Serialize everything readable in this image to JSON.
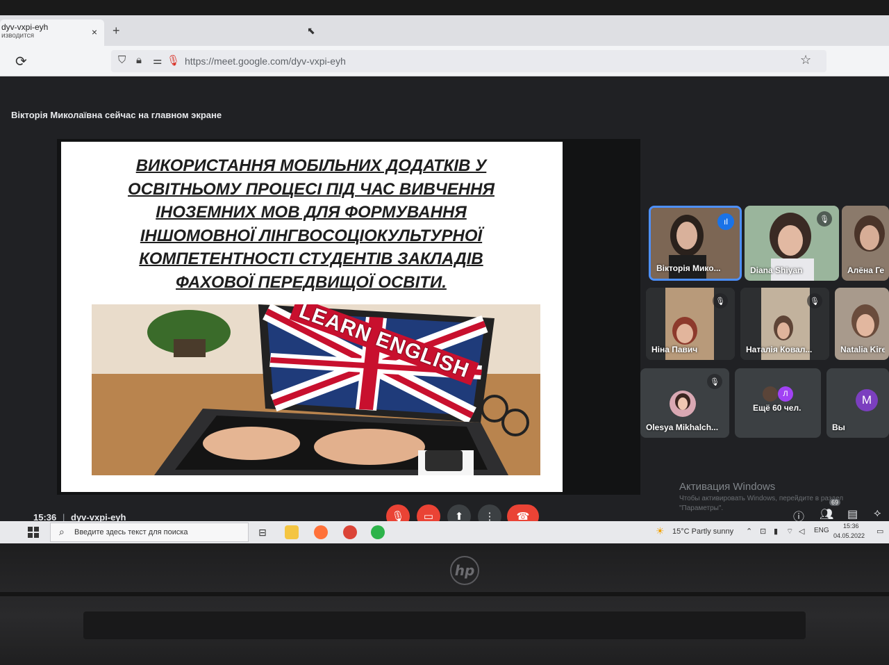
{
  "browser": {
    "tab_title": "dyv-vxpi-eyh",
    "tab_subtitle": "изводится",
    "tab_close": "×",
    "new_tab": "+",
    "url": "https://meet.google.com/dyv-vxpi-eyh"
  },
  "meet": {
    "presenter_banner": "Вікторія Миколаївна сейчас на главном экране",
    "slide": {
      "title_lines": [
        "ВИКОРИСТАННЯ МОБІЛЬНИХ ДОДАТКІВ У",
        "ОСВІТНЬОМУ ПРОЦЕСІ ПІД ЧАС ВИВЧЕННЯ",
        "ІНОЗЕМНИХ МОВ ДЛЯ ФОРМУВАННЯ",
        "ІНШОМОВНОЇ ЛІНГВОСОЦІОКУЛЬТУРНОЇ",
        "КОМПЕТЕНТНОСТІ СТУДЕНТІВ ЗАКЛАДІВ",
        "ФАХОВОЇ ПЕРЕДВИЩОЇ ОСВІТИ."
      ],
      "image_text": "LEARN ENGLISH"
    },
    "participants": [
      {
        "name": "Вікторія Мико...",
        "state": "speaking"
      },
      {
        "name": "Diana Shiyan",
        "state": "muted"
      },
      {
        "name": "Алёна Ге",
        "state": "none"
      },
      {
        "name": "Ніна Павич",
        "state": "muted"
      },
      {
        "name": "Наталія Ковал...",
        "state": "muted"
      },
      {
        "name": "Natalia Kiree",
        "state": "none"
      },
      {
        "name": "Olesya Mikhalch...",
        "state": "muted"
      },
      {
        "name": "Ещё 60 чел.",
        "state": "none",
        "avatar_letter": "Л"
      },
      {
        "name": "Вы",
        "state": "none",
        "avatar_letter": "M"
      }
    ],
    "watermark": {
      "title": "Активация Windows",
      "subtitle": "Чтобы активировать Windows, перейдите в раздел \"Параметры\"."
    },
    "footer": {
      "time": "15:36",
      "divider": "|",
      "meeting_code": "dyv-vxpi-eyh",
      "participant_count": "69"
    },
    "colors": {
      "end_call": "#ea4335",
      "muted_control": "#ea4335",
      "speaking": "#1a73e8",
      "background": "#202124"
    }
  },
  "taskbar": {
    "search_placeholder": "Введите здесь текст для поиска",
    "weather": "15°C  Partly sunny",
    "language": "ENG",
    "clock_time": "15:36",
    "clock_date": "04.05.2022"
  }
}
